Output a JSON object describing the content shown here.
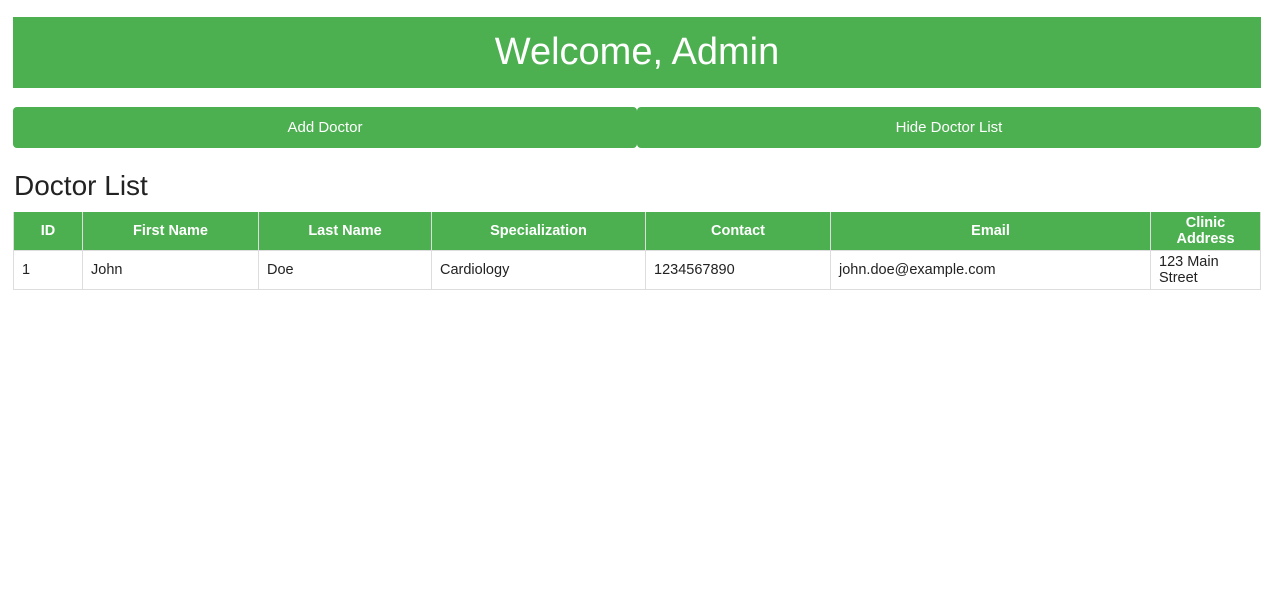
{
  "header": {
    "title": "Welcome, Admin"
  },
  "actions": {
    "add_doctor_label": "Add Doctor",
    "hide_list_label": "Hide Doctor List"
  },
  "doctor_list": {
    "title": "Doctor List",
    "columns": [
      "ID",
      "First Name",
      "Last Name",
      "Specialization",
      "Contact",
      "Email",
      "Clinic Address"
    ],
    "rows": [
      [
        "1",
        "John",
        "Doe",
        "Cardiology",
        "1234567890",
        "john.doe@example.com",
        "123 Main Street"
      ]
    ]
  },
  "colors": {
    "accent": "#4caf50",
    "border": "#dddddd",
    "text": "#222222"
  }
}
